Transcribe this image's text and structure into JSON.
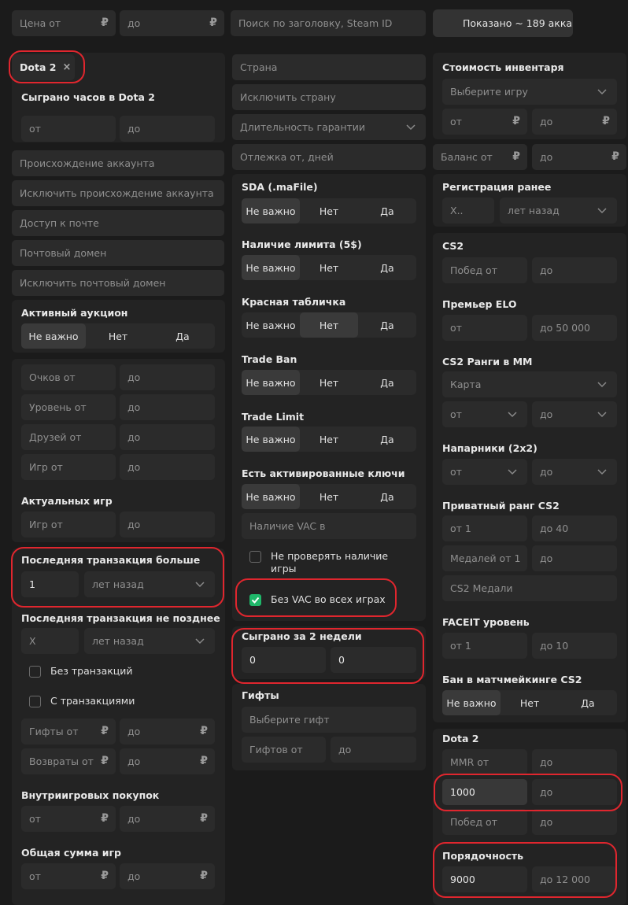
{
  "top": {
    "price_from": "Цена от",
    "price_to": "до",
    "rub": "₽",
    "search_placeholder": "Поиск по заголовку, Steam ID",
    "shown_label": "Показано ~ 189 акка"
  },
  "game_tag": {
    "label": "Dota 2",
    "close": "×"
  },
  "col1": {
    "hours_title": "Сыграно часов в Dota 2",
    "from": "от",
    "to": "до",
    "origin": "Происхождение аккаунта",
    "exclude_origin": "Исключить происхождение аккаунта",
    "mail_access": "Доступ к почте",
    "mail_domain": "Почтовый домен",
    "exclude_mail_domain": "Исключить почтовый домен",
    "auction_title": "Активный аукцион",
    "seg_any": "Не важно",
    "seg_no": "Нет",
    "seg_yes": "Да",
    "points_from": "Очков от",
    "level_from": "Уровень от",
    "friends_from": "Друзей от",
    "games_from": "Игр от",
    "actual_games_title": "Актуальных игр",
    "last_tx_more_title": "Последняя транзакция больше",
    "last_tx_more_value": "1",
    "years_ago": "лет назад",
    "last_tx_not_later_title": "Последняя транзакция не позднее",
    "x_placeholder": "X",
    "no_tx": "Без транзакций",
    "with_tx": "С транзакциями",
    "gifts_from": "Гифты от",
    "refunds_from": "Возвраты от",
    "ingame_title": "Внутриигровых покупок",
    "total_games_title": "Общая сумма игр"
  },
  "col2": {
    "country": "Страна",
    "exclude_country": "Исключить страну",
    "warranty": "Длительность гарантии",
    "rest_days": "Отлежка от, дней",
    "sda_title": "SDA (.maFile)",
    "limit_title": "Наличие лимита (5$)",
    "red_plate_title": "Красная табличка",
    "trade_ban_title": "Trade Ban",
    "trade_limit_title": "Trade Limit",
    "keys_title": "Есть активированные ключи",
    "vac_in": "Наличие VAC в",
    "no_check_vac": "Не проверять наличие игры",
    "no_vac_all": "Без VAC во всех играх",
    "two_weeks_title": "Сыграно за 2 недели",
    "two_weeks_from": "0",
    "two_weeks_to": "0",
    "gifts_title": "Гифты",
    "choose_gift": "Выберите гифт",
    "gifts_from": "Гифтов от",
    "to": "до"
  },
  "col3": {
    "inventory_title": "Стоимость инвентаря",
    "choose_game": "Выберите игру",
    "from": "от",
    "to": "до",
    "balance_from": "Баланс от",
    "reg_title": "Регистрация ранее",
    "reg_x": "X..",
    "years_ago": "лет назад",
    "cs2_title": "CS2",
    "wins_from": "Побед от",
    "premier_title": "Премьер ELO",
    "premier_to": "до 50 000",
    "ranks_title": "CS2 Ранги в ММ",
    "map": "Карта",
    "partners_title": "Напарники (2х2)",
    "private_title": "Приватный ранг CS2",
    "private_from": "от 1",
    "private_to": "до 40",
    "medals_from": "Медалей от 1",
    "medals": "CS2 Медали",
    "faceit_title": "FACEIT уровень",
    "faceit_from": "от 1",
    "faceit_to": "до 10",
    "ban_title": "Бан в матчмейкинге CS2",
    "dota_title": "Dota 2",
    "mmr_from": "MMR от",
    "mmr_value": "1000",
    "decency_title": "Порядочность",
    "decency_from": "9000",
    "decency_to": "до 12 000"
  },
  "colors": {
    "accent_green": "#1fb86a",
    "highlight_red": "#e0262e",
    "background": "#1b1b1b",
    "panel": "#232323",
    "input": "#2b2b2b"
  },
  "icons": [
    "ruble-sign",
    "close-icon",
    "chevron-down-icon",
    "checkmark-icon"
  ]
}
